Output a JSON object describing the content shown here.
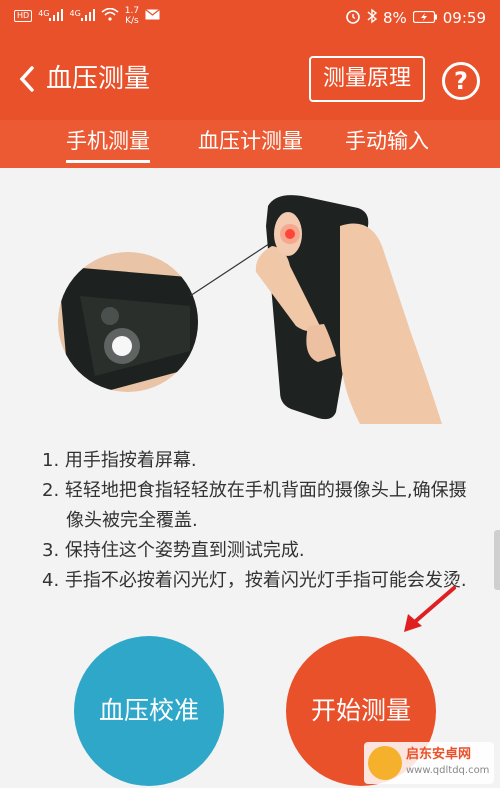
{
  "status_bar": {
    "left_badge": "HD",
    "net_type_1": "4G",
    "net_type_2": "4G",
    "net_speed_value": "1.7",
    "net_speed_unit": "K/s",
    "battery": "8%",
    "time": "09:59"
  },
  "header": {
    "title": "血压测量",
    "principle_label": "测量原理",
    "help_label": "?"
  },
  "tabs": [
    {
      "label": "手机测量",
      "active": true
    },
    {
      "label": "血压计测量",
      "active": false
    },
    {
      "label": "手动输入",
      "active": false
    }
  ],
  "instructions": [
    "1. 用手指按着屏幕.",
    "2. 轻轻地把食指轻轻放在手机背面的摄像头上,确保摄像头被完全覆盖.",
    "3. 保持住这个姿势直到测试完成.",
    "4. 手指不必按着闪光灯，按着闪光灯手指可能会发烫."
  ],
  "buttons": {
    "calibrate": "血压校准",
    "start": "开始测量"
  },
  "watermark": {
    "name": "启东安卓网",
    "url": "www.qdltdq.com"
  },
  "colors": {
    "primary": "#e9512b",
    "secondary": "#2fa7c8",
    "background": "#f3f3f3"
  }
}
